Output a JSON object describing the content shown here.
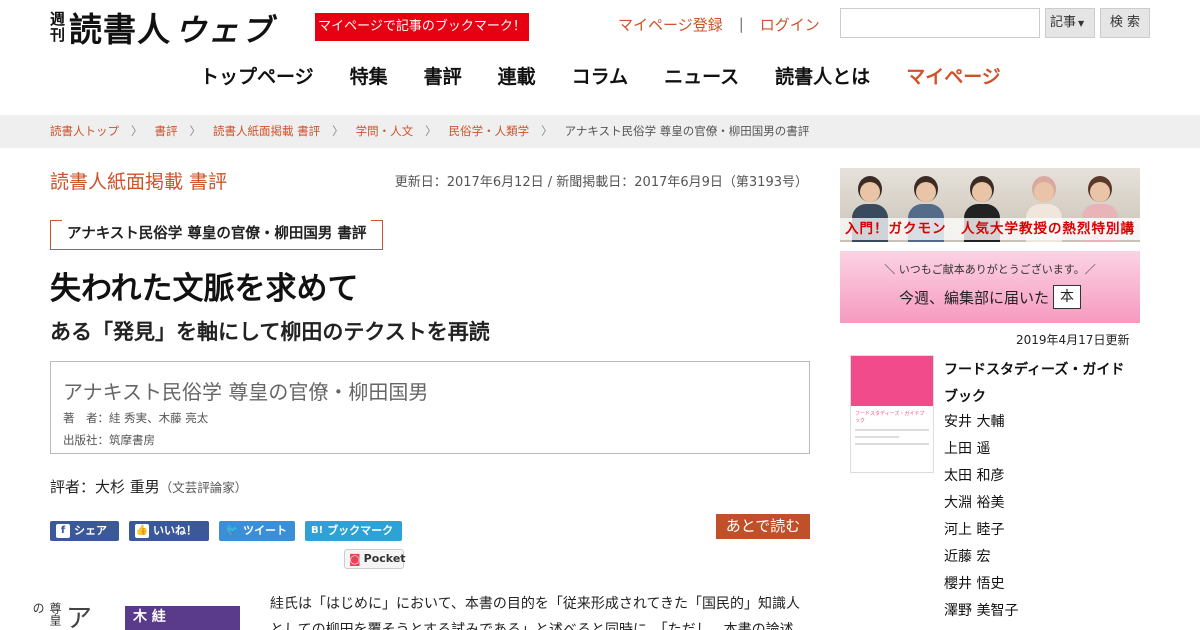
{
  "header": {
    "logo_weekly_1": "週",
    "logo_weekly_2": "刊",
    "logo_main": "読書人",
    "logo_web": "ウェブ",
    "bookmark_promo": "マイページで記事のブックマーク！",
    "register_link": "マイページ登録",
    "separator": "|",
    "login_link": "ログイン",
    "search_placeholder": "",
    "search_scope": "記事",
    "search_button": "検 索"
  },
  "nav": {
    "items": [
      "トップページ",
      "特集",
      "書評",
      "連載",
      "コラム",
      "ニュース",
      "読書人とは",
      "マイページ"
    ]
  },
  "breadcrumb": {
    "items": [
      "読書人トップ",
      "書評",
      "読書人紙面掲載 書評",
      "学問・人文",
      "民俗学・人類学"
    ],
    "current": "アナキスト民俗学 尊皇の官僚・柳田国男の書評",
    "arrow": "〉"
  },
  "article": {
    "section_label": "読書人紙面掲載 書評",
    "dates": "更新日：2017年6月12日 / 新聞掲載日：2017年6月9日（第3193号）",
    "book_tag": "アナキスト民俗学 尊皇の官僚・柳田国男 書評",
    "headline": "失われた文脈を求めて",
    "subheadline": "ある「発見」を軸にして柳田のテクストを再読",
    "book": {
      "title": "アナキスト民俗学 尊皇の官僚・柳田国男",
      "authors": "著　者：絓 秀実、木藤 亮太",
      "publisher": "出版社：筑摩書房"
    },
    "reviewer_prefix": "評者：",
    "reviewer_name": "大杉 重男",
    "reviewer_role": "（文芸評論家）",
    "share": {
      "facebook": "シェア",
      "like": "いいね！",
      "twitter": "ツイート",
      "hatena_icon": "B!",
      "hatena": "ブックマーク",
      "pocket": "Pocket"
    },
    "read_later": "あとで読む",
    "cover_text_1": "尊皇の",
    "cover_text_2": "ア",
    "cover_text_3": "木 絓",
    "body_line_1": "絓氏は「はじめに」において、本書の目的を「従来形成されてきた「国民的」知識人",
    "body_line_2": "としての柳田を覆そうとする試みである」と述べると同時に、「ただし、本書の論述"
  },
  "sidebar": {
    "banner1_title": "入門！ガクモン　人気大学教授の熱烈特別講義",
    "banner2_small": "＼ いつもご献本ありがとうございます。／",
    "banner2_big": "今週、編集部に届いた",
    "banner2_box": "本",
    "updated": "2019年4月17日更新",
    "book_title": "フードスタディーズ・ガイドブック",
    "cover_title": "フードスタディーズ・ガイドブック",
    "authors": [
      "安井 大輔",
      "上田 遥",
      "太田 和彦",
      "大淵 裕美",
      "河上 睦子",
      "近藤 宏",
      "櫻井 悟史",
      "澤野 美智子"
    ]
  },
  "colors": {
    "accent": "#d0522a",
    "promo_red": "#e60012",
    "facebook": "#3b5998",
    "twitter": "#3b8fd9",
    "hatena": "#2ea2d4",
    "read_later": "#c0502a",
    "breadcrumb_bg": "#efefef"
  },
  "icons": {
    "facebook": "facebook-icon",
    "like": "thumbs-up-icon",
    "twitter": "twitter-bird-icon",
    "hatena": "hatena-bookmark-icon",
    "pocket": "pocket-icon",
    "dropdown": "chevron-down-icon"
  }
}
